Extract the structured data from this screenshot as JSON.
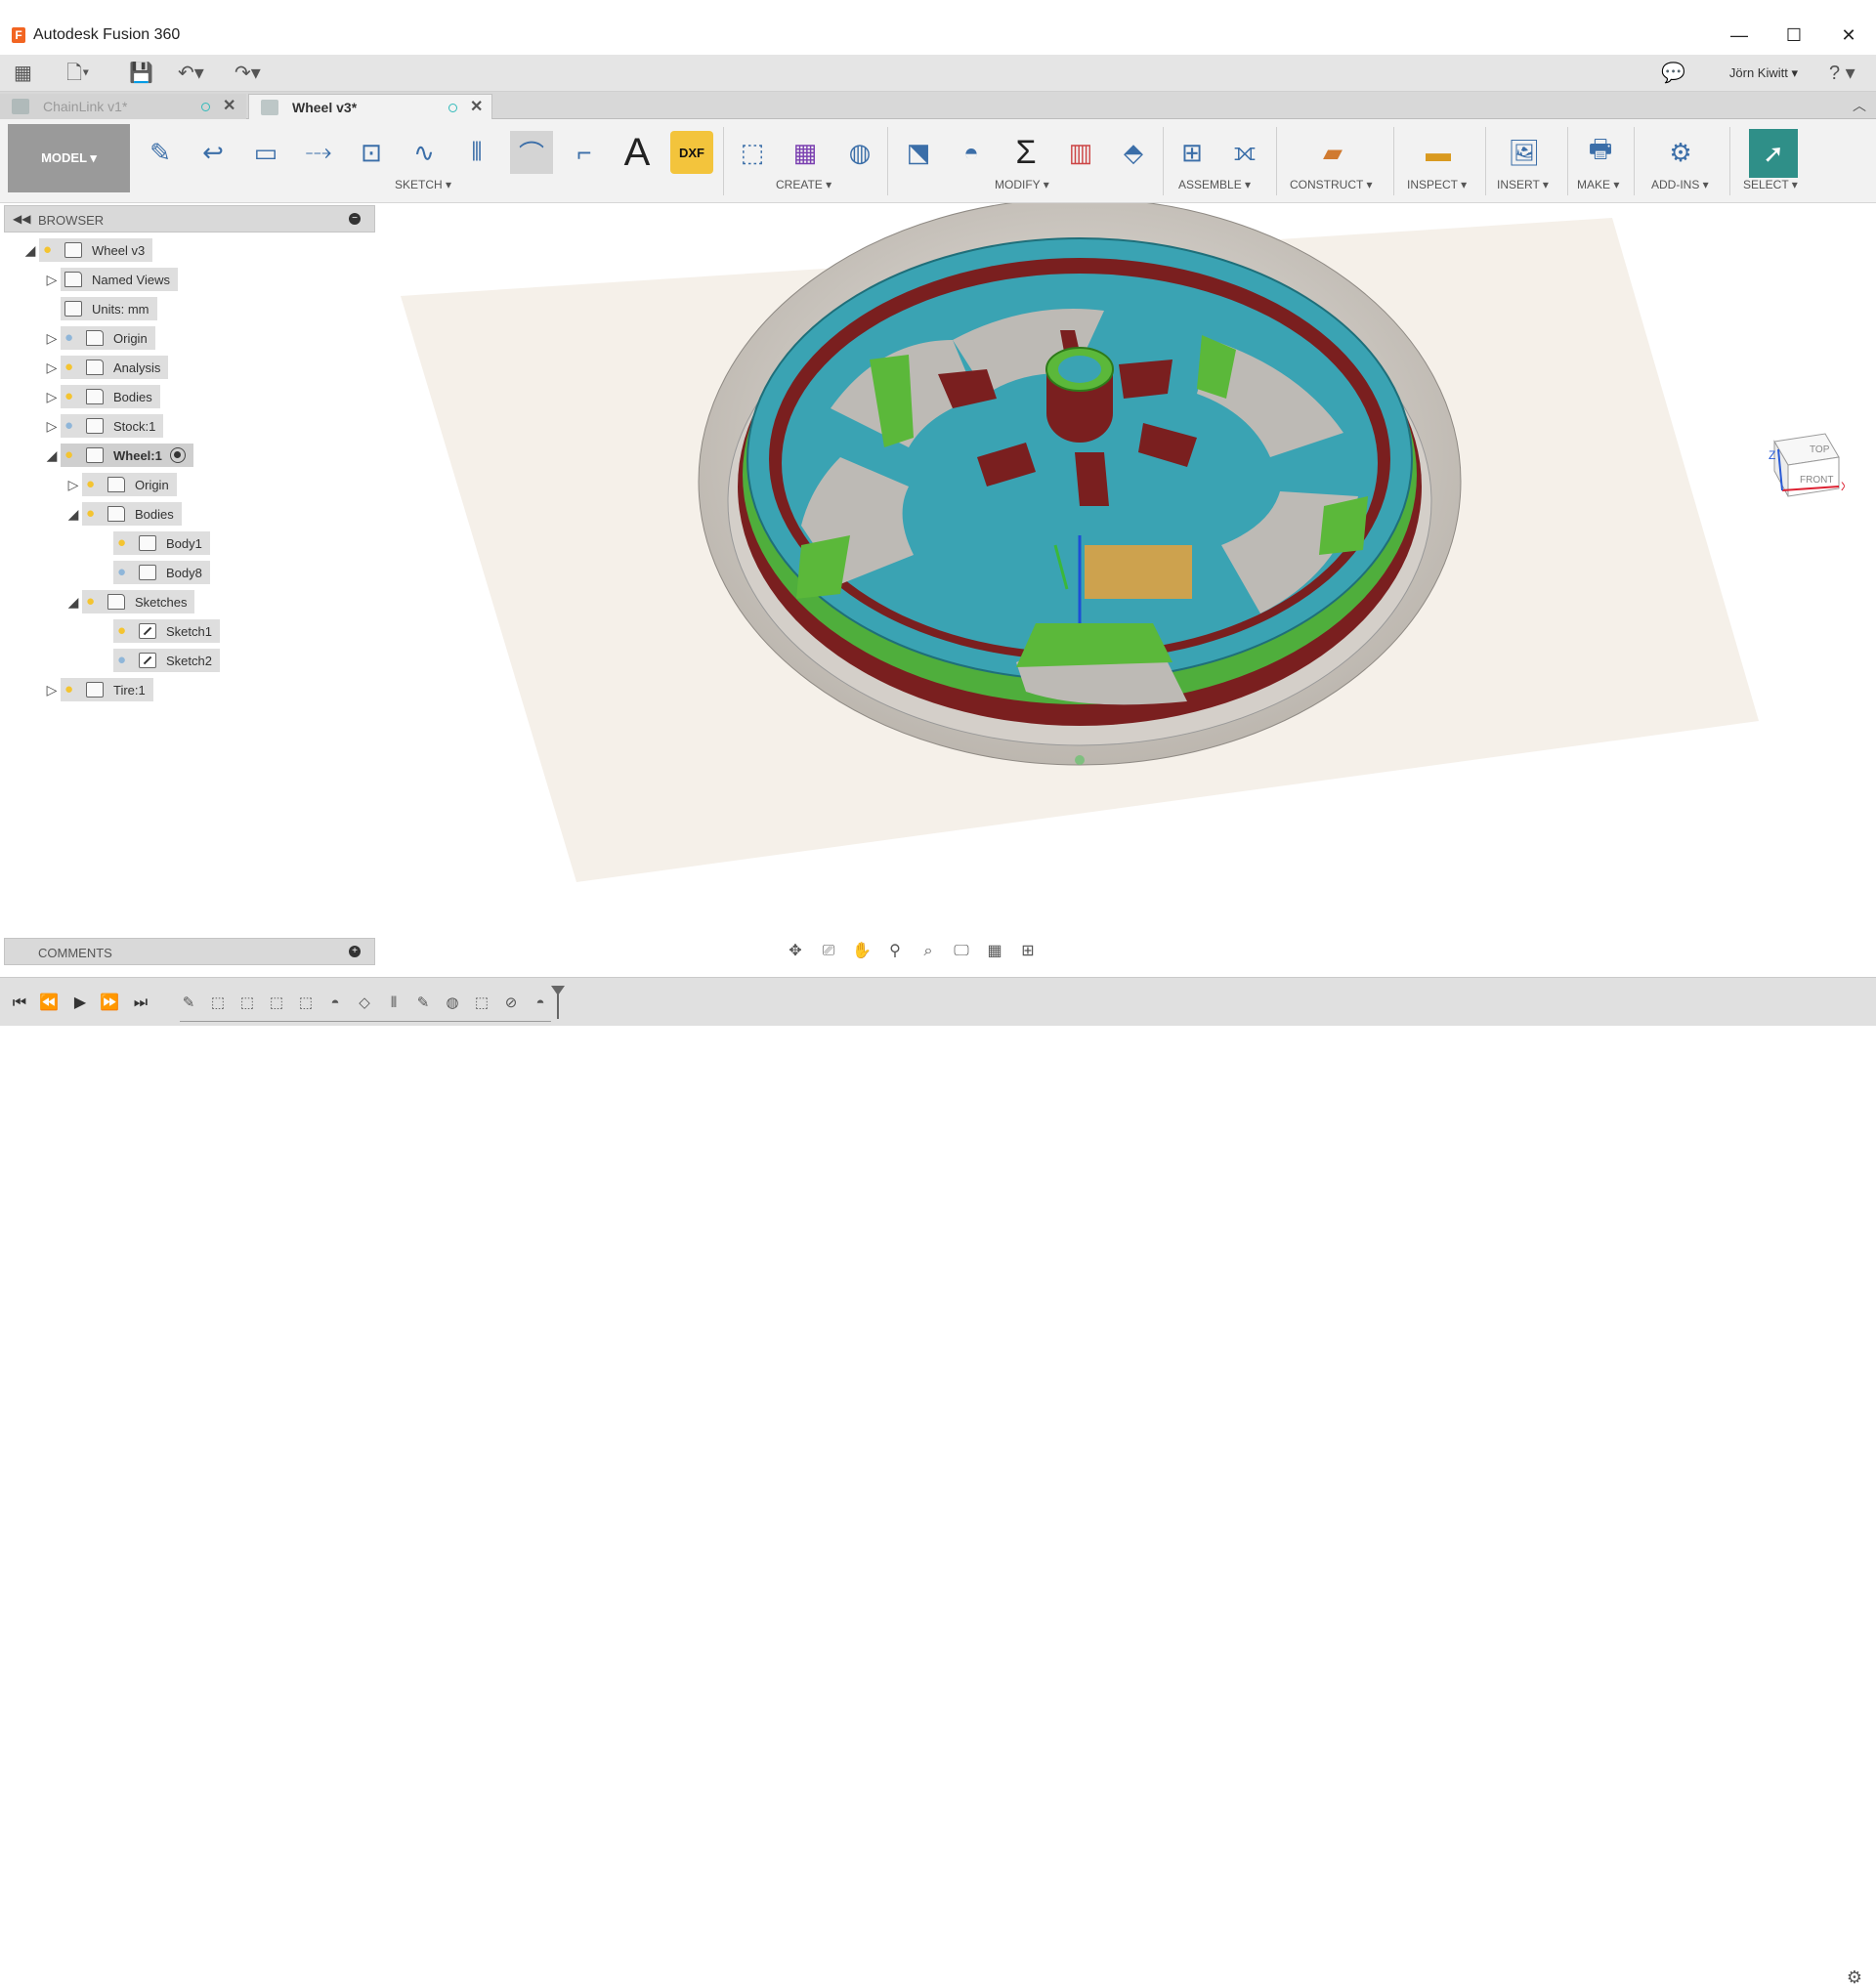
{
  "window": {
    "title": "Autodesk Fusion 360",
    "app_logo": "F",
    "controls": [
      "—",
      "☐",
      "✕"
    ]
  },
  "qat": {
    "grid_icon": "apps-grid-icon",
    "file_icon": "file-icon",
    "save_icon": "save-icon",
    "undo_icon": "undo-icon",
    "redo_icon": "redo-icon",
    "comment_icon": "comment-icon",
    "user": "Jörn Kiwitt ▾",
    "help": "? ▾"
  },
  "tabs": [
    {
      "label": "ChainLink v1*",
      "active": false
    },
    {
      "label": "Wheel v3*",
      "active": true
    }
  ],
  "toolbar": {
    "workspace": "MODEL ▾",
    "groups": [
      {
        "label": "SKETCH ▾"
      },
      {
        "label": "CREATE ▾"
      },
      {
        "label": "MODIFY ▾"
      },
      {
        "label": "ASSEMBLE ▾"
      },
      {
        "label": "CONSTRUCT ▾"
      },
      {
        "label": "INSPECT ▾"
      },
      {
        "label": "INSERT ▾"
      },
      {
        "label": "MAKE ▾"
      },
      {
        "label": "ADD-INS ▾"
      },
      {
        "label": "SELECT ▾"
      }
    ],
    "dxf_label": "DXF",
    "text_tool": "A",
    "sum_tool": "Σ"
  },
  "browser": {
    "label": "BROWSER",
    "tree": [
      {
        "label": "Wheel v3",
        "icon": "component-icon",
        "bulb": "on"
      },
      {
        "label": "Named Views",
        "icon": "folder-icon"
      },
      {
        "label": "Units: mm",
        "icon": "document-icon"
      },
      {
        "label": "Origin",
        "icon": "folder-icon",
        "bulb": "off"
      },
      {
        "label": "Analysis",
        "icon": "folder-icon",
        "bulb": "on"
      },
      {
        "label": "Bodies",
        "icon": "folder-icon",
        "bulb": "on"
      },
      {
        "label": "Stock:1",
        "icon": "body-icon",
        "bulb": "off"
      },
      {
        "label": "Wheel:1",
        "icon": "body-icon",
        "bulb": "on",
        "active": true
      },
      {
        "label": "Origin",
        "icon": "folder-icon",
        "bulb": "on"
      },
      {
        "label": "Bodies",
        "icon": "folder-icon",
        "bulb": "on"
      },
      {
        "label": "Body1",
        "icon": "body-icon",
        "bulb": "on"
      },
      {
        "label": "Body8",
        "icon": "body-icon",
        "bulb": "off"
      },
      {
        "label": "Sketches",
        "icon": "folder-icon",
        "bulb": "on"
      },
      {
        "label": "Sketch1",
        "icon": "sketch-icon",
        "bulb": "on"
      },
      {
        "label": "Sketch2",
        "icon": "sketch-icon",
        "bulb": "off"
      },
      {
        "label": "Tire:1",
        "icon": "body-icon",
        "bulb": "on"
      }
    ]
  },
  "comments": {
    "label": "COMMENTS"
  },
  "viewcube": {
    "top": "TOP",
    "front": "FRONT",
    "axis_x": "X",
    "axis_z": "Z"
  },
  "colors": {
    "rim_teal": "#3aa3b3",
    "spoke_green": "#5bb83a",
    "hub_red": "#7a1f1f",
    "tire_gray": "#cfcac4",
    "ground_plane": "#f3ece4",
    "select_highlight": "#2f8f88"
  }
}
